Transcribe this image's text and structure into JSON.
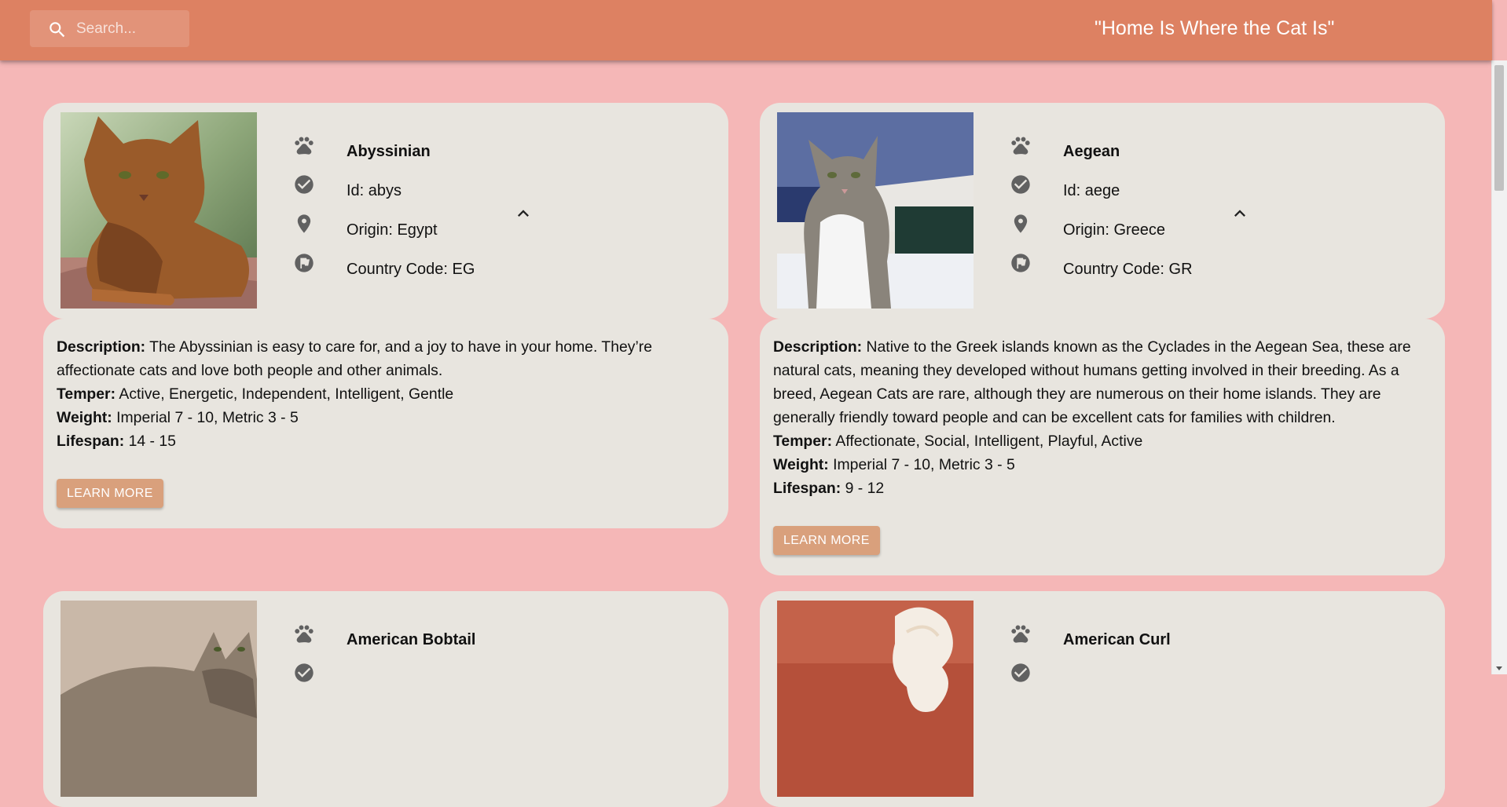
{
  "header": {
    "search_placeholder": "Search...",
    "search_value": "",
    "tagline": "\"Home Is Where the Cat Is\""
  },
  "breeds": [
    {
      "name": "Abyssinian",
      "id": "Id: abys",
      "origin": "Origin: Egypt",
      "country_code": "Country Code: EG",
      "description_label": "Description:",
      "description": "The Abyssinian is easy to care for, and a joy to have in your home. They’re affectionate cats and love both people and other animals.",
      "temper_label": "Temper:",
      "temper": "Active, Energetic, Independent, Intelligent, Gentle",
      "weight_label": "Weight:",
      "weight": "Imperial 7 - 10, Metric 3 - 5",
      "lifespan_label": "Lifespan:",
      "lifespan": "14 - 15",
      "button_label": "LEARN MORE"
    },
    {
      "name": "Aegean",
      "id": "Id: aege",
      "origin": "Origin: Greece",
      "country_code": "Country Code: GR",
      "description_label": "Description:",
      "description": "Native to the Greek islands known as the Cyclades in the Aegean Sea, these are natural cats, meaning they developed without humans getting involved in their breeding. As a breed, Aegean Cats are rare, although they are numerous on their home islands. They are generally friendly toward people and can be excellent cats for families with children.",
      "temper_label": "Temper:",
      "temper": "Affectionate, Social, Intelligent, Playful, Active",
      "weight_label": "Weight:",
      "weight": "Imperial 7 - 10, Metric 3 - 5",
      "lifespan_label": "Lifespan:",
      "lifespan": "9 - 12",
      "button_label": "LEARN MORE"
    },
    {
      "name": "American Bobtail"
    },
    {
      "name": "American Curl"
    }
  ],
  "colors": {
    "appbar": "#dd8162",
    "page_background": "#f5b7b7",
    "card_background": "#e8e5df",
    "button": "#d9a07c",
    "icon": "#616161"
  },
  "icons": {
    "search": "search-icon",
    "name": "paw-icon",
    "id": "check-circle-icon",
    "origin": "location-pin-icon",
    "country_code": "flag-circle-icon",
    "toggle": "chevron-up-icon"
  }
}
